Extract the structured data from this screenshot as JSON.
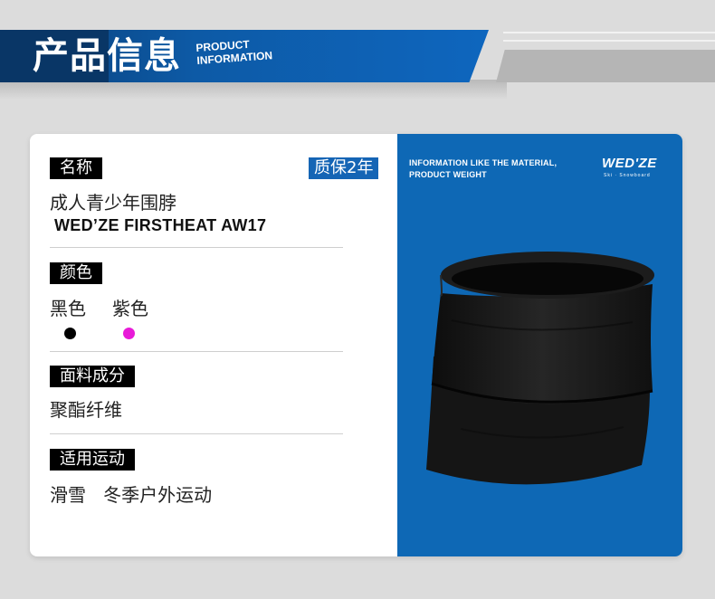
{
  "header": {
    "title": "产品信息",
    "subtitle_line1": "PRODUCT",
    "subtitle_line2": "INFORMATION"
  },
  "sections": {
    "name": {
      "tag": "名称",
      "warranty": "质保2年",
      "product_name": "成人青少年围脖",
      "model": "WED’ZE FIRSTHEAT AW17"
    },
    "color": {
      "tag": "颜色",
      "options": [
        {
          "label": "黑色",
          "swatch": "#000000"
        },
        {
          "label": "紫色",
          "swatch": "#e81ad8"
        }
      ]
    },
    "material": {
      "tag": "面料成分",
      "value": "聚酯纤维"
    },
    "sports": {
      "tag": "适用运动",
      "value": "滑雪   冬季户外运动"
    }
  },
  "image_panel": {
    "caption_line1": "INFORMATION LIKE THE MATERIAL,",
    "caption_line2": "PRODUCT WEIGHT",
    "brand": "WED'ZE",
    "brand_tagline": "Ski · Snowboard",
    "background_color": "#0e68b5",
    "product_image": "black-fleece-neck-warmer"
  }
}
